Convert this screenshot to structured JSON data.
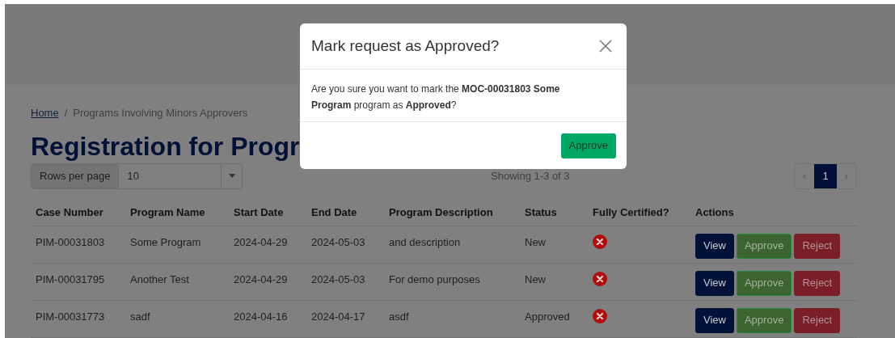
{
  "breadcrumb": {
    "home": "Home",
    "separator": "/",
    "current": "Programs Involving Minors Approvers"
  },
  "page_title": "Registration for Progr",
  "rows_per_page": {
    "label": "Rows per page",
    "value": "10"
  },
  "showing": "Showing 1-3 of 3",
  "pagination": {
    "prev": "‹",
    "next": "›",
    "pages": [
      {
        "label": "1",
        "selected": true
      }
    ]
  },
  "table": {
    "columns": [
      "Case Number",
      "Program Name",
      "Start Date",
      "End Date",
      "Program Description",
      "Status",
      "Fully Certified?",
      "Actions"
    ],
    "rows": [
      {
        "cells": [
          "PIM-00031803",
          "Some Program",
          "2024-04-29",
          "2024-05-03",
          "and description",
          "New"
        ],
        "certified": false,
        "actions": [
          {
            "label": "View",
            "kind": "view"
          },
          {
            "label": "Approve",
            "kind": "approve"
          },
          {
            "label": "Reject",
            "kind": "reject"
          }
        ]
      },
      {
        "cells": [
          "PIM-00031795",
          "Another Test",
          "2024-04-29",
          "2024-05-03",
          "For demo purposes",
          "New"
        ],
        "certified": false,
        "actions": [
          {
            "label": "View",
            "kind": "view"
          },
          {
            "label": "Approve",
            "kind": "approve"
          },
          {
            "label": "Reject",
            "kind": "reject"
          }
        ]
      },
      {
        "cells": [
          "PIM-00031773",
          "sadf",
          "2024-04-16",
          "2024-04-17",
          "asdf",
          "Approved"
        ],
        "certified": false,
        "actions": [
          {
            "label": "View",
            "kind": "view"
          },
          {
            "label": "Approve",
            "kind": "approve"
          },
          {
            "label": "Reject",
            "kind": "reject"
          }
        ]
      }
    ]
  },
  "modal": {
    "title": "Mark request as Approved?",
    "message": "Are you sure you want to mark the **MOC-00031803 Some Program** program as **Approved**?",
    "button": "Approve"
  }
}
